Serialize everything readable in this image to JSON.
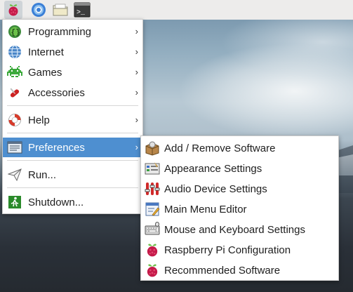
{
  "taskbar": {
    "buttons": [
      {
        "name": "raspberry-menu-icon"
      },
      {
        "name": "browser-icon"
      },
      {
        "name": "file-manager-icon"
      },
      {
        "name": "terminal-icon",
        "label": ">_"
      }
    ]
  },
  "main_menu": {
    "items": [
      {
        "label": "Programming",
        "icon": "programming-icon",
        "has_submenu": true
      },
      {
        "label": "Internet",
        "icon": "globe-icon",
        "has_submenu": true
      },
      {
        "label": "Games",
        "icon": "space-invader-icon",
        "has_submenu": true
      },
      {
        "label": "Accessories",
        "icon": "swiss-knife-icon",
        "has_submenu": true
      },
      {
        "label": "Help",
        "icon": "lifebuoy-icon",
        "has_submenu": true
      },
      {
        "label": "Preferences",
        "icon": "preferences-icon",
        "has_submenu": true,
        "active": true
      },
      {
        "label": "Run...",
        "icon": "paper-plane-icon",
        "has_submenu": false
      },
      {
        "label": "Shutdown...",
        "icon": "exit-icon",
        "has_submenu": false
      }
    ],
    "arrow": "›"
  },
  "preferences_submenu": {
    "items": [
      {
        "label": "Add / Remove Software",
        "icon": "package-icon"
      },
      {
        "label": "Appearance Settings",
        "icon": "appearance-icon"
      },
      {
        "label": "Audio Device Settings",
        "icon": "audio-mixer-icon"
      },
      {
        "label": "Main Menu Editor",
        "icon": "menu-editor-icon"
      },
      {
        "label": "Mouse and Keyboard Settings",
        "icon": "keyboard-icon"
      },
      {
        "label": "Raspberry Pi Configuration",
        "icon": "raspberry-icon"
      },
      {
        "label": "Recommended Software",
        "icon": "raspberry-icon"
      }
    ]
  },
  "colors": {
    "highlight": "#4e8fd0",
    "raspberry": "#c51a4a",
    "leaf": "#6cc04a"
  }
}
